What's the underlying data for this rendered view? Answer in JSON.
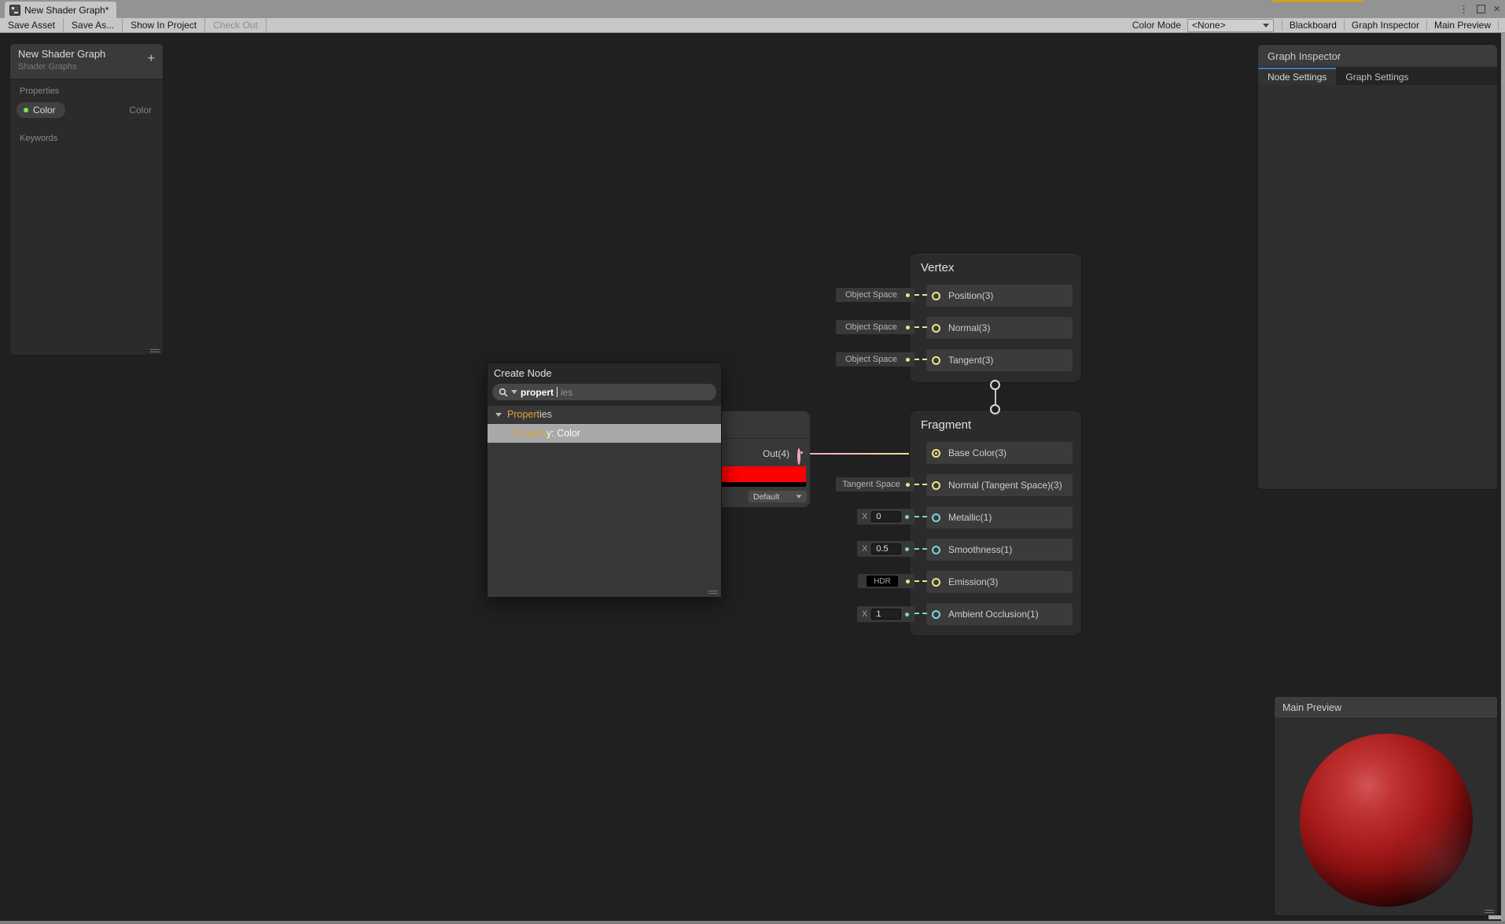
{
  "window": {
    "tab_title": "New Shader Graph*",
    "menu_glyph": "⋮",
    "close_glyph": "×"
  },
  "toolbar": {
    "buttons_left": [
      {
        "label": "Save Asset"
      },
      {
        "label": "Save As..."
      },
      {
        "label": "Show In Project"
      },
      {
        "label": "Check Out"
      }
    ],
    "color_mode_label": "Color Mode",
    "color_mode_value": "<None>",
    "buttons_right": [
      {
        "label": "Blackboard"
      },
      {
        "label": "Graph Inspector"
      },
      {
        "label": "Main Preview"
      }
    ]
  },
  "blackboard": {
    "title": "New Shader Graph",
    "subtitle": "Shader Graphs",
    "add_label": "+",
    "properties_label": "Properties",
    "keywords_label": "Keywords",
    "property": {
      "name": "Color",
      "type": "Color"
    }
  },
  "graph_inspector": {
    "title": "Graph Inspector",
    "tabs": [
      {
        "label": "Node Settings"
      },
      {
        "label": "Graph Settings"
      }
    ]
  },
  "create_node": {
    "title": "Create Node",
    "search_text": "propert",
    "search_hint": "ies",
    "section_match": "Propert",
    "section_rest": "ies",
    "item_match": "Propert",
    "item_rest": "y: Color"
  },
  "color_node": {
    "out_label": "Out(4)",
    "mode_value": "Default"
  },
  "vertex_node": {
    "title": "Vertex",
    "rows": [
      {
        "chip": "Object Space",
        "label": "Position(3)"
      },
      {
        "chip": "Object Space",
        "label": "Normal(3)"
      },
      {
        "chip": "Object Space",
        "label": "Tangent(3)"
      }
    ]
  },
  "fragment_node": {
    "title": "Fragment",
    "rows": [
      {
        "label": "Base Color(3)"
      },
      {
        "chip": "Tangent Space",
        "label": "Normal (Tangent Space)(3)"
      },
      {
        "field_label": "X",
        "field_value": "0",
        "label": "Metallic(1)"
      },
      {
        "field_label": "X",
        "field_value": "0.5",
        "label": "Smoothness(1)"
      },
      {
        "chip": "HDR",
        "label": "Emission(3)"
      },
      {
        "field_label": "X",
        "field_value": "1",
        "label": "Ambient Occlusion(1)"
      }
    ]
  },
  "main_preview": {
    "title": "Main Preview"
  },
  "colors": {
    "accent_blue": "#3E7DBA",
    "port_vec3": "#EDE77F",
    "port_vec1": "#7FD4DA",
    "port_vec4": "#F0A8C9",
    "wire_from": "#F0A9C9",
    "wire_to": "#EDE793",
    "swatch_red": "#FF0000",
    "match_orange": "#E2A33C",
    "dot_green": "#7CE94F",
    "strip_yellow": "#C9A227"
  }
}
